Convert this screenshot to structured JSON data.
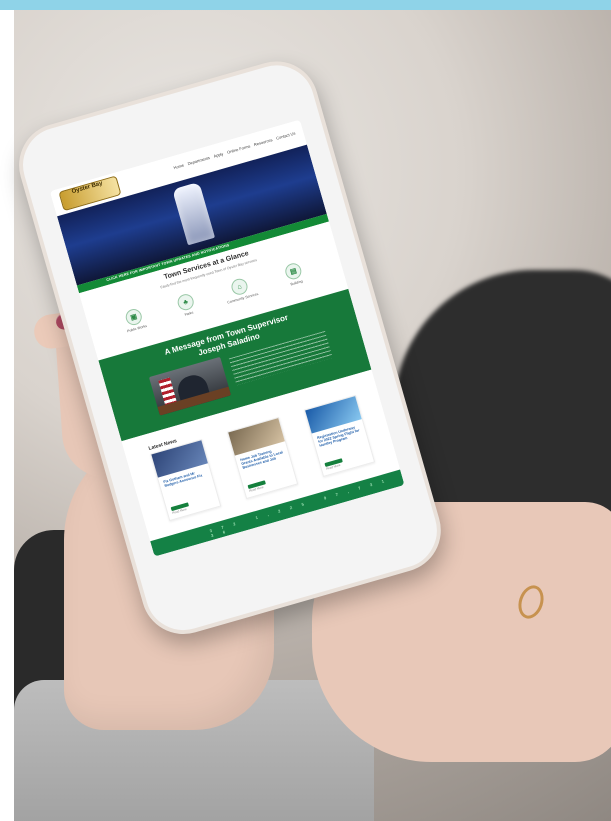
{
  "image": {
    "name": "hand-holding-smartphone-town-website"
  },
  "website": {
    "logo_text": "Oyster Bay",
    "nav_items": [
      "Home",
      "Departments",
      "Apply",
      "Online Forms",
      "Resources",
      "Contact Us"
    ],
    "hero_banner_text": "CLICK HERE FOR IMPORTANT TOWN UPDATES AND NOTIFICATIONS",
    "services_title": "Town Services at a Glance",
    "services_subtitle": "Easily find the most frequently used Town of Oyster Bay services",
    "services": [
      {
        "label": "Public Works"
      },
      {
        "label": "Parks"
      },
      {
        "label": "Community Services"
      },
      {
        "label": "Building"
      }
    ],
    "message_title_line1": "A Message from Town Supervisor",
    "message_title_line2": "Joseph Saladino",
    "news_title": "Latest News",
    "news_cards": [
      {
        "title": "Fix Gotham and Mr Rodgers Announce Fix",
        "meta": "Read More"
      },
      {
        "title": "Home Job Training Grants Available to Local Businesses and Job",
        "meta": "Read More"
      },
      {
        "title": "Registration Underway for 2022 Spring Flight for Huntley Program",
        "meta": "Read More"
      }
    ],
    "footer_numbers": [
      "372",
      "1,225",
      "97,731",
      "36"
    ]
  }
}
